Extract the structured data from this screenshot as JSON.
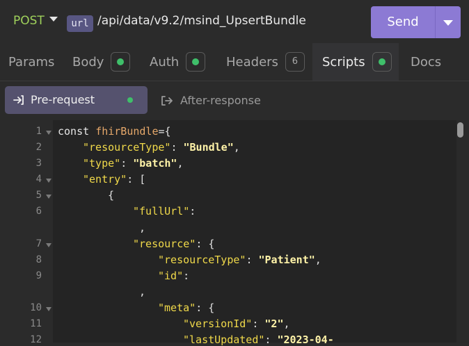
{
  "request": {
    "method": "POST",
    "url_tag": "url",
    "url_path": "/api/data/v9.2/msind_UpsertBundle",
    "send_label": "Send"
  },
  "tabs": [
    {
      "label": "Params"
    },
    {
      "label": "Body",
      "indicator": "dot"
    },
    {
      "label": "Auth",
      "indicator": "dot"
    },
    {
      "label": "Headers",
      "count": "6"
    },
    {
      "label": "Scripts",
      "indicator": "dot",
      "active": true
    },
    {
      "label": "Docs"
    }
  ],
  "script_tabs": {
    "pre_request": "Pre-request",
    "after_response": "After-response"
  },
  "editor": {
    "line_numbers": [
      "1",
      "2",
      "3",
      "4",
      "5",
      "6",
      "",
      "7",
      "8",
      "9",
      "",
      "10",
      "11",
      "12"
    ],
    "lines": [
      "const fhirBundle={",
      "\"resourceType\": \"Bundle\",",
      "\"type\": \"batch\",",
      "\"entry\": [",
      "{",
      "\"fullUrl\":",
      ",",
      "\"resource\": {",
      "\"resourceType\": \"Patient\",",
      "\"id\":",
      ",",
      "\"meta\": {",
      "\"versionId\": \"2\",",
      "\"lastUpdated\": \"2023-04-"
    ]
  },
  "colors": {
    "method": "#9fd15b",
    "send_button": "#8c7ad4",
    "active_dot": "#3fbf6a",
    "json_key": "#f0d94a",
    "json_string": "#fff3a8"
  }
}
